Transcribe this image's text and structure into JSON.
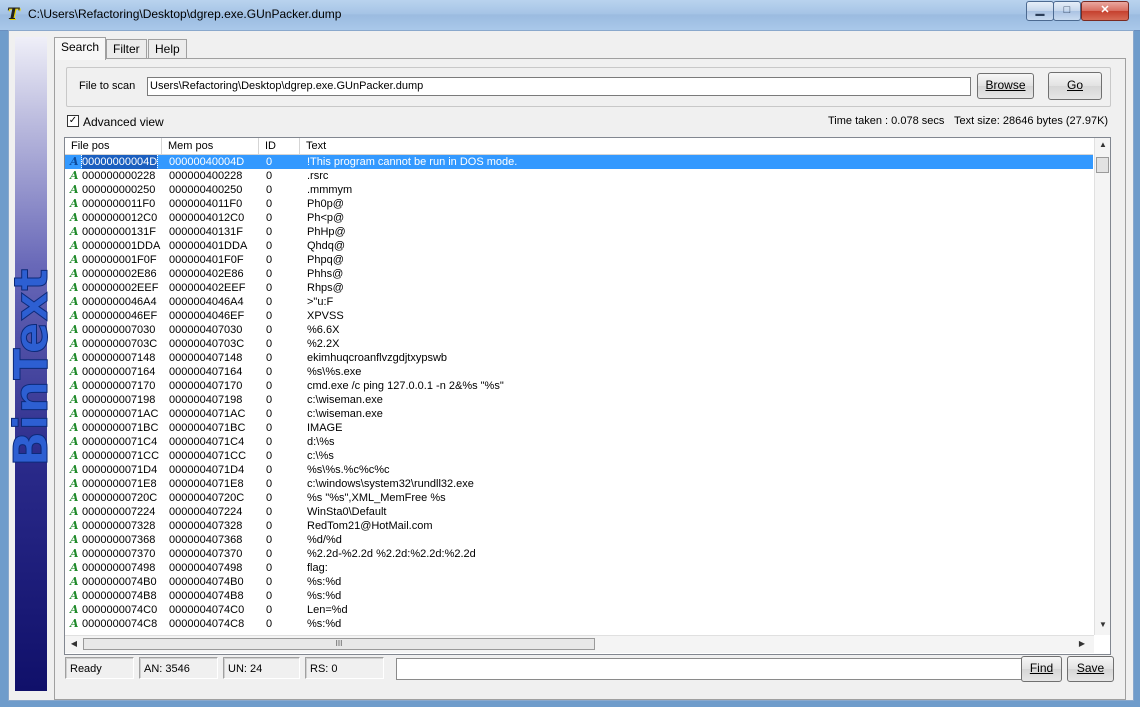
{
  "window": {
    "title": "C:\\Users\\Refactoring\\Desktop\\dgrep.exe.GUnPacker.dump",
    "app_icon": "T",
    "min_glyph": "▁",
    "max_glyph": "□",
    "close_glyph": "✕"
  },
  "banner": {
    "text": "BinText"
  },
  "tabs": [
    {
      "label": "Search"
    },
    {
      "label": "Filter"
    },
    {
      "label": "Help"
    }
  ],
  "search": {
    "file_label": "File to scan",
    "file_value": "Users\\Refactoring\\Desktop\\dgrep.exe.GUnPacker.dump",
    "browse_label": "Browse",
    "go_label": "Go",
    "advanced_view_label": "Advanced view",
    "advanced_view_checked": "✓",
    "time_taken": "Time taken : 0.078 secs",
    "text_size": "Text size: 28646 bytes (27.97K)"
  },
  "list": {
    "columns": [
      "File pos",
      "Mem pos",
      "ID",
      "Text"
    ],
    "row_icon": "A",
    "rows": [
      [
        "00000000004D",
        "00000040004D",
        "0",
        "!This program cannot be run in DOS mode."
      ],
      [
        "000000000228",
        "000000400228",
        "0",
        ".rsrc"
      ],
      [
        "000000000250",
        "000000400250",
        "0",
        ".mmmym"
      ],
      [
        "0000000011F0",
        "0000004011F0",
        "0",
        "Ph0p@"
      ],
      [
        "0000000012C0",
        "0000004012C0",
        "0",
        "Ph<p@"
      ],
      [
        "00000000131F",
        "00000040131F",
        "0",
        "PhHp@"
      ],
      [
        "000000001DDA",
        "000000401DDA",
        "0",
        "Qhdq@"
      ],
      [
        "000000001F0F",
        "000000401F0F",
        "0",
        "Phpq@"
      ],
      [
        "000000002E86",
        "000000402E86",
        "0",
        "Phhs@"
      ],
      [
        "000000002EEF",
        "000000402EEF",
        "0",
        "Rhps@"
      ],
      [
        "0000000046A4",
        "0000004046A4",
        "0",
        ">\"u:F"
      ],
      [
        "0000000046EF",
        "0000004046EF",
        "0",
        "XPVSS"
      ],
      [
        "000000007030",
        "000000407030",
        "0",
        "%6.6X"
      ],
      [
        "00000000703C",
        "00000040703C",
        "0",
        "%2.2X"
      ],
      [
        "000000007148",
        "000000407148",
        "0",
        "ekimhuqcroanflvzgdjtxypswb"
      ],
      [
        "000000007164",
        "000000407164",
        "0",
        "%s\\%s.exe"
      ],
      [
        "000000007170",
        "000000407170",
        "0",
        "cmd.exe /c ping 127.0.0.1 -n 2&%s \"%s\""
      ],
      [
        "000000007198",
        "000000407198",
        "0",
        "c:\\wiseman.exe"
      ],
      [
        "0000000071AC",
        "0000004071AC",
        "0",
        "c:\\wiseman.exe"
      ],
      [
        "0000000071BC",
        "0000004071BC",
        "0",
        "IMAGE"
      ],
      [
        "0000000071C4",
        "0000004071C4",
        "0",
        "d:\\%s"
      ],
      [
        "0000000071CC",
        "0000004071CC",
        "0",
        "c:\\%s"
      ],
      [
        "0000000071D4",
        "0000004071D4",
        "0",
        "%s\\%s.%c%c%c"
      ],
      [
        "0000000071E8",
        "0000004071E8",
        "0",
        "c:\\windows\\system32\\rundll32.exe"
      ],
      [
        "00000000720C",
        "00000040720C",
        "0",
        "%s \"%s\",XML_MemFree %s"
      ],
      [
        "000000007224",
        "000000407224",
        "0",
        "WinSta0\\Default"
      ],
      [
        "000000007328",
        "000000407328",
        "0",
        "RedTom21@HotMail.com"
      ],
      [
        "000000007368",
        "000000407368",
        "0",
        "%d/%d"
      ],
      [
        "000000007370",
        "000000407370",
        "0",
        "%2.2d-%2.2d %2.2d:%2.2d:%2.2d"
      ],
      [
        "000000007498",
        "000000407498",
        "0",
        "flag:"
      ],
      [
        "0000000074B0",
        "0000004074B0",
        "0",
        "%s:%d"
      ],
      [
        "0000000074B8",
        "0000004074B8",
        "0",
        "%s:%d"
      ],
      [
        "0000000074C0",
        "0000004074C0",
        "0",
        "Len=%d"
      ],
      [
        "0000000074C8",
        "0000004074C8",
        "0",
        "%s:%d"
      ]
    ],
    "hscroll_grip": "III",
    "up_arrow": "▲",
    "down_arrow": "▼",
    "left_arrow": "◀",
    "right_arrow": "▶"
  },
  "status": {
    "ready": "Ready",
    "an": "AN: 3546",
    "un": "UN: 24",
    "rs": "RS: 0",
    "find_label": "Find",
    "save_label": "Save"
  }
}
